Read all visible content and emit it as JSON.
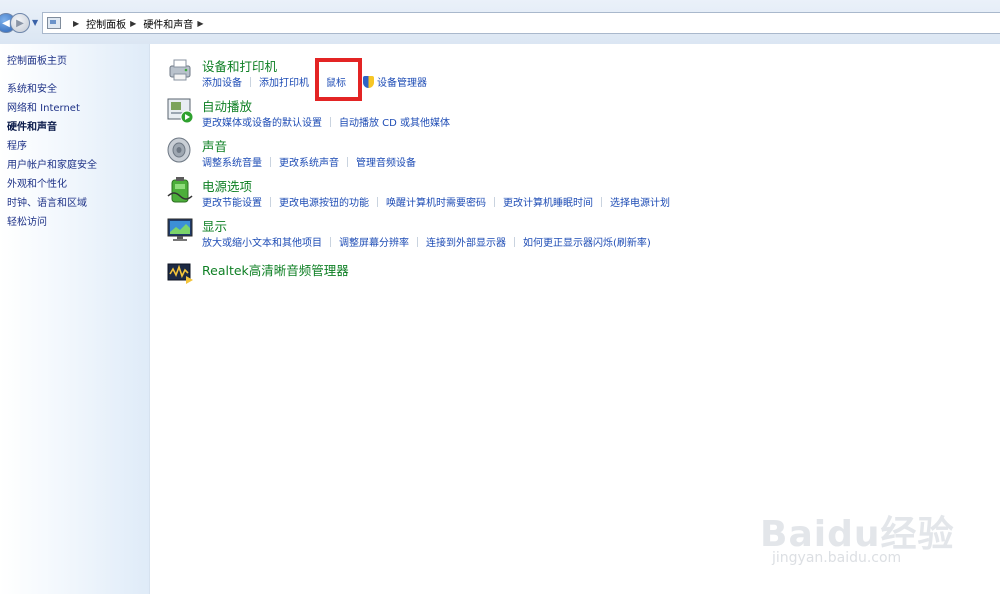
{
  "breadcrumb": {
    "items": [
      "控制面板",
      "硬件和声音"
    ]
  },
  "sidebar": {
    "items": [
      {
        "label": "控制面板主页",
        "active": false
      },
      {
        "label": "系统和安全",
        "active": false
      },
      {
        "label": "网络和 Internet",
        "active": false
      },
      {
        "label": "硬件和声音",
        "active": true
      },
      {
        "label": "程序",
        "active": false
      },
      {
        "label": "用户帐户和家庭安全",
        "active": false
      },
      {
        "label": "外观和个性化",
        "active": false
      },
      {
        "label": "时钟、语言和区域",
        "active": false
      },
      {
        "label": "轻松访问",
        "active": false
      }
    ]
  },
  "groups": [
    {
      "title": "设备和打印机",
      "icon": "printer-icon",
      "links": [
        "添加设备",
        "添加打印机",
        "鼠标",
        "设备管理器"
      ]
    },
    {
      "title": "自动播放",
      "icon": "autoplay-icon",
      "links": [
        "更改媒体或设备的默认设置",
        "自动播放 CD 或其他媒体"
      ]
    },
    {
      "title": "声音",
      "icon": "speaker-icon",
      "links": [
        "调整系统音量",
        "更改系统声音",
        "管理音频设备"
      ]
    },
    {
      "title": "电源选项",
      "icon": "battery-icon",
      "links": [
        "更改节能设置",
        "更改电源按钮的功能",
        "唤醒计算机时需要密码",
        "更改计算机睡眠时间",
        "选择电源计划"
      ]
    },
    {
      "title": "显示",
      "icon": "monitor-icon",
      "links": [
        "放大或缩小文本和其他项目",
        "调整屏幕分辨率",
        "连接到外部显示器",
        "如何更正显示器闪烁(刷新率)"
      ]
    },
    {
      "title": "Realtek高清晰音频管理器",
      "icon": "realtek-audio-icon",
      "links": []
    }
  ],
  "watermark": {
    "brand": "Baidu经验",
    "url": "jingyan.baidu.com"
  },
  "colors": {
    "title_green": "#0f8025",
    "link_blue": "#1e4cb5",
    "highlight_red": "#e32424"
  }
}
